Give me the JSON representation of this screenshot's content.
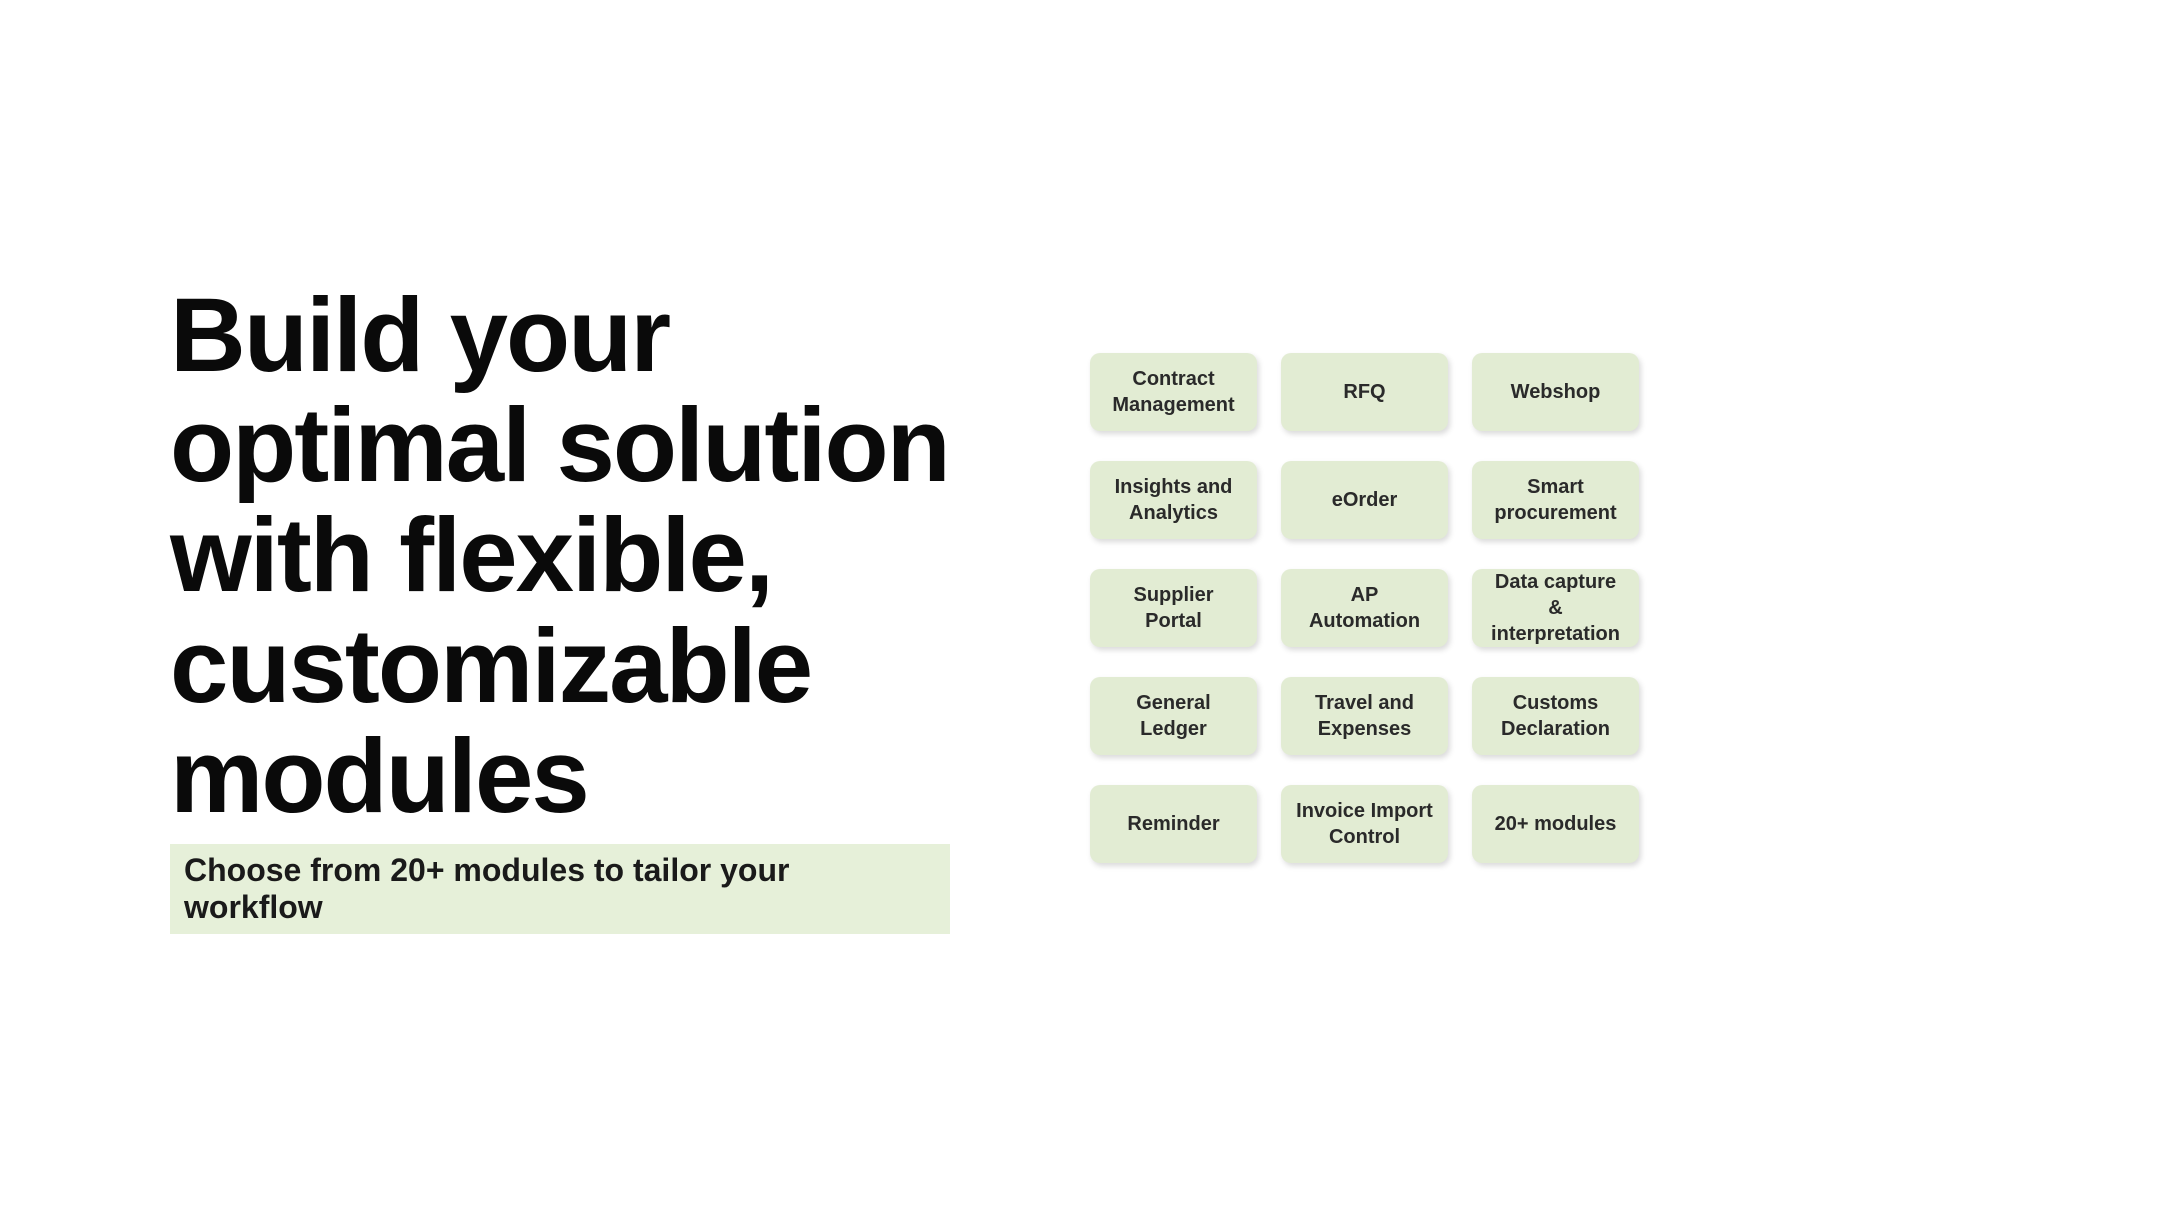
{
  "hero": {
    "headline": "Build your optimal solution with flexible, customizable modules",
    "subtitle": "Choose from 20+ modules to tailor your workflow"
  },
  "modules": [
    "Contract Management",
    "RFQ",
    "Webshop",
    "Insights and Analytics",
    "eOrder",
    "Smart procurement",
    "Supplier Portal",
    "AP Automation",
    "Data capture & interpretation",
    "General Ledger",
    "Travel and Expenses",
    "Customs Declaration",
    "Reminder",
    "Invoice Import Control",
    "20+ modules"
  ]
}
